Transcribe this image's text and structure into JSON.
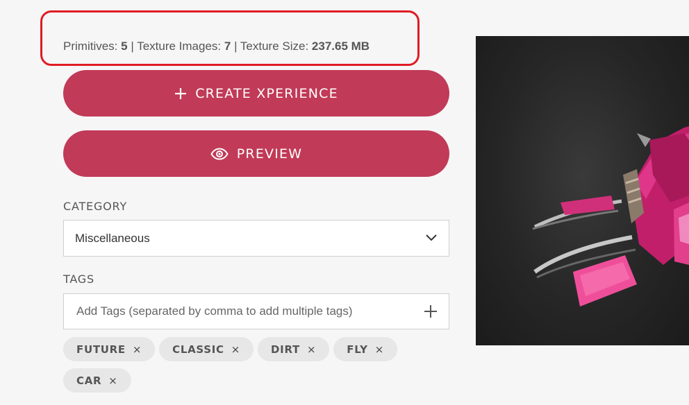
{
  "stats": {
    "primitives_label": "Primitives:",
    "primitives_value": "5",
    "texture_images_label": "Texture Images:",
    "texture_images_value": "7",
    "texture_size_label": "Texture Size:",
    "texture_size_value": "237.65 MB",
    "separator": "|"
  },
  "buttons": {
    "create_label": "CREATE XPERIENCE",
    "create_icon": "plus-icon",
    "preview_label": "PREVIEW",
    "preview_icon": "eye-icon"
  },
  "category": {
    "label": "CATEGORY",
    "selected": "Miscellaneous",
    "icon": "chevron-down-icon"
  },
  "tags": {
    "label": "TAGS",
    "placeholder": "Add Tags (separated by comma to add multiple tags)",
    "add_icon": "plus-icon",
    "remove_symbol": "×",
    "items": [
      "FUTURE",
      "CLASSIC",
      "DIRT",
      "FLY",
      "CAR"
    ]
  },
  "colors": {
    "accent": "#c13a57",
    "highlight": "#e01b24",
    "background": "#f6f6f6",
    "chip_bg": "#e7e7e7"
  }
}
